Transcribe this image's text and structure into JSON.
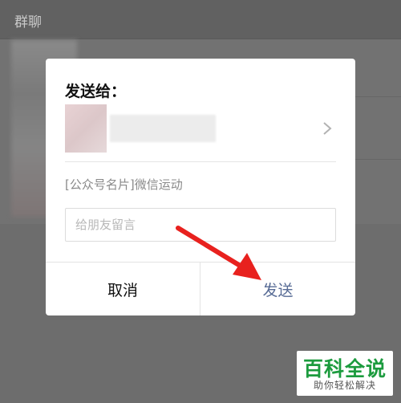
{
  "background": {
    "header_title": "群聊"
  },
  "dialog": {
    "title": "发送给：",
    "share_card_text": "[公众号名片]微信运动",
    "message_placeholder": "给朋友留言",
    "cancel_label": "取消",
    "send_label": "发送",
    "icons": {
      "chevron": "chevron-right-icon",
      "arrow": "red-arrow-annotation"
    }
  },
  "watermark": {
    "main_text": "百科全说",
    "sub_text": "助你轻松解决"
  },
  "colors": {
    "overlay_bg": "#6d6d6d",
    "send_accent": "#576b95",
    "arrow_red": "#e8211e",
    "watermark_green": "#1c9b3e"
  }
}
